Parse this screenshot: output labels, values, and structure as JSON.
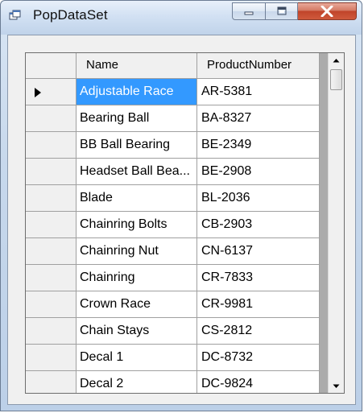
{
  "window": {
    "title": "PopDataSet",
    "icon": "form-icon",
    "controls": [
      "minimize-icon",
      "maximize-icon",
      "close-icon"
    ]
  },
  "grid": {
    "columns": [
      "Name",
      "ProductNumber"
    ],
    "rows": [
      {
        "name": "Adjustable Race",
        "number": "AR-5381"
      },
      {
        "name": "Bearing Ball",
        "number": "BA-8327"
      },
      {
        "name": "BB Ball Bearing",
        "number": "BE-2349"
      },
      {
        "name": "Headset Ball Bea...",
        "number": "BE-2908"
      },
      {
        "name": "Blade",
        "number": "BL-2036"
      },
      {
        "name": "Chainring Bolts",
        "number": "CB-2903"
      },
      {
        "name": "Chainring Nut",
        "number": "CN-6137"
      },
      {
        "name": "Chainring",
        "number": "CR-7833"
      },
      {
        "name": "Crown Race",
        "number": "CR-9981"
      },
      {
        "name": "Chain Stays",
        "number": "CS-2812"
      },
      {
        "name": "Decal 1",
        "number": "DC-8732"
      },
      {
        "name": "Decal 2",
        "number": "DC-9824"
      }
    ],
    "selected_row": 0,
    "selected_color": "#3399ff"
  }
}
